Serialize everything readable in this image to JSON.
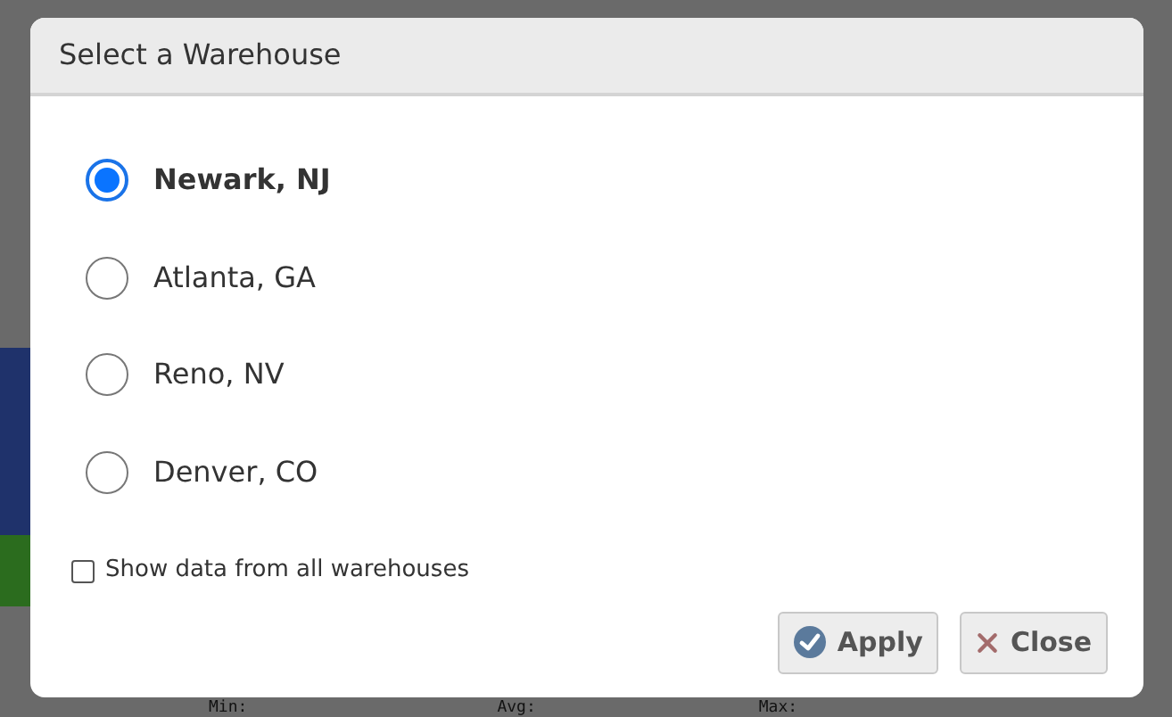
{
  "background": {
    "footer_labels": [
      "Min:",
      "Avg:",
      "Max:"
    ]
  },
  "dialog": {
    "title": "Select a Warehouse",
    "options": [
      {
        "label": "Newark, NJ",
        "selected": true
      },
      {
        "label": "Atlanta, GA",
        "selected": false
      },
      {
        "label": "Reno, NV",
        "selected": false
      },
      {
        "label": "Denver, CO",
        "selected": false
      }
    ],
    "show_all": {
      "label": "Show data from all warehouses",
      "checked": false
    },
    "buttons": [
      {
        "label": "Apply",
        "kind": "apply"
      },
      {
        "label": "Close",
        "kind": "close"
      }
    ]
  }
}
